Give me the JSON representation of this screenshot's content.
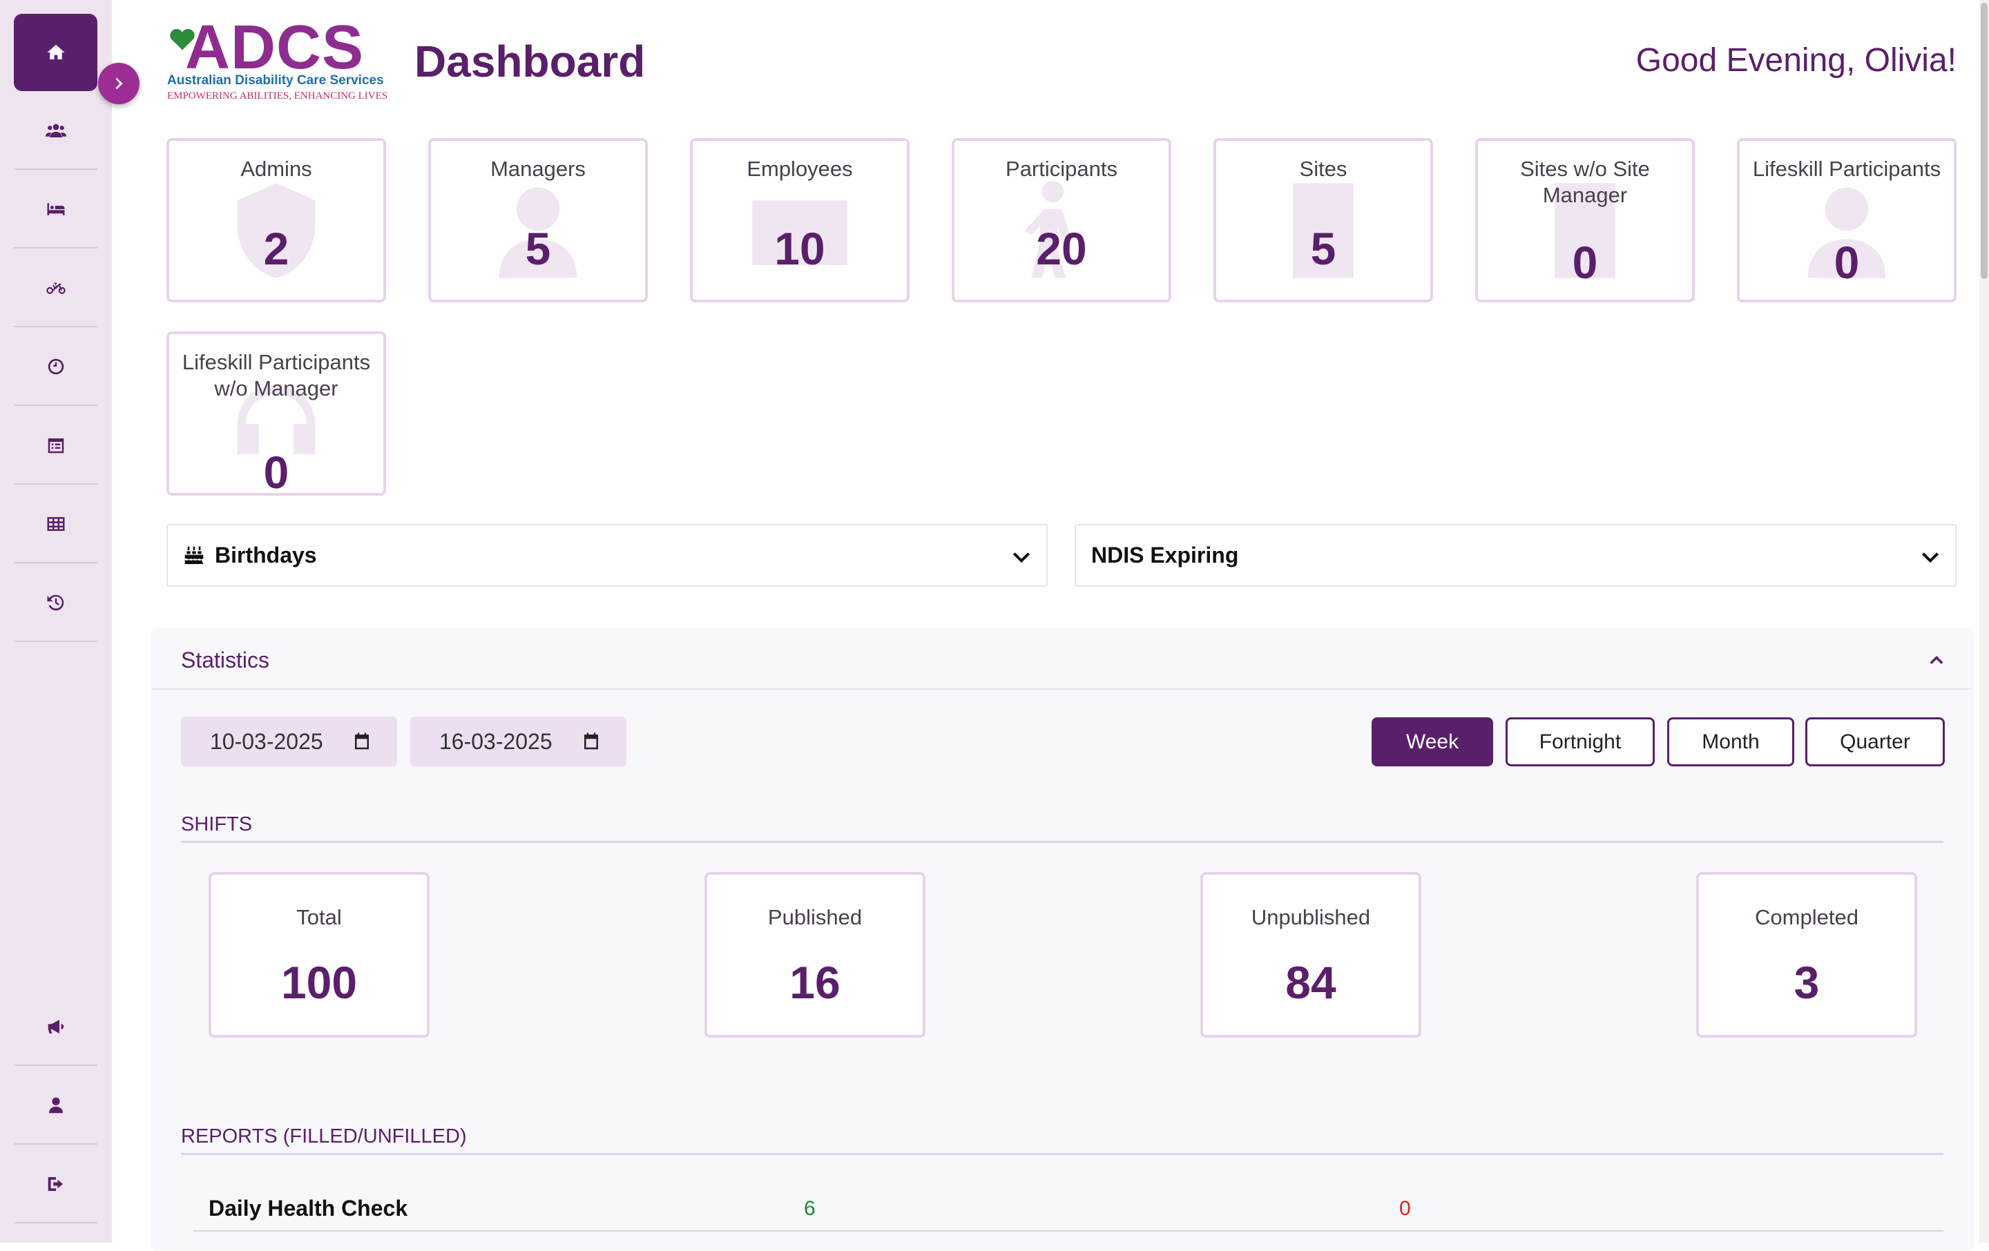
{
  "app": {
    "logo_text": "ADCS",
    "logo_subtitle": "Australian Disability Care Services",
    "logo_tagline": "EMPOWERING ABILITIES, ENHANCING LIVES"
  },
  "header": {
    "title": "Dashboard",
    "greeting": "Good Evening, Olivia!"
  },
  "sidebar": {
    "items": [
      {
        "icon": "home-icon",
        "active": true
      },
      {
        "icon": "users-icon"
      },
      {
        "icon": "bed-icon"
      },
      {
        "icon": "bicycle-icon"
      },
      {
        "icon": "clock-icon"
      },
      {
        "icon": "calendar-list-icon"
      },
      {
        "icon": "table-icon"
      },
      {
        "icon": "history-icon"
      },
      {
        "icon": "megaphone-icon"
      },
      {
        "icon": "user-icon"
      },
      {
        "icon": "logout-icon"
      }
    ],
    "toggle_icon": "chevron-right-icon"
  },
  "stat_cards": [
    {
      "label": "Admins",
      "value": "2",
      "icon": "shield-icon"
    },
    {
      "label": "Managers",
      "value": "5",
      "icon": "user-tie-icon"
    },
    {
      "label": "Employees",
      "value": "10",
      "icon": "id-card-icon"
    },
    {
      "label": "Participants",
      "value": "20",
      "icon": "person-cane-icon"
    },
    {
      "label": "Sites",
      "value": "5",
      "icon": "building-icon"
    },
    {
      "label": "Sites w/o Site Manager",
      "value": "0",
      "icon": "building-icon"
    },
    {
      "label": "Lifeskill Participants",
      "value": "0",
      "icon": "user-icon"
    },
    {
      "label": "Lifeskill Participants w/o Manager",
      "value": "0",
      "icon": "headset-icon"
    }
  ],
  "accordions": {
    "birthdays": {
      "title": "Birthdays",
      "icon": "birthday-cake-icon"
    },
    "ndis": {
      "title": "NDIS Expiring"
    }
  },
  "statistics": {
    "title": "Statistics",
    "date_from": "10-03-2025",
    "date_to": "16-03-2025",
    "ranges": [
      "Week",
      "Fortnight",
      "Month",
      "Quarter"
    ],
    "selected_range": "Week",
    "shifts_label": "SHIFTS",
    "shifts": [
      {
        "label": "Total",
        "value": "100"
      },
      {
        "label": "Published",
        "value": "16"
      },
      {
        "label": "Unpublished",
        "value": "84"
      },
      {
        "label": "Completed",
        "value": "3"
      }
    ],
    "reports_label": "REPORTS (FILLED/UNFILLED)",
    "reports": [
      {
        "name": "Daily Health Check",
        "filled": "6",
        "unfilled": "0"
      }
    ]
  },
  "colors": {
    "primary": "#5a1f6a",
    "accent": "#9c2d94",
    "filled": "#1e8a2c",
    "unfilled": "#e02020"
  }
}
